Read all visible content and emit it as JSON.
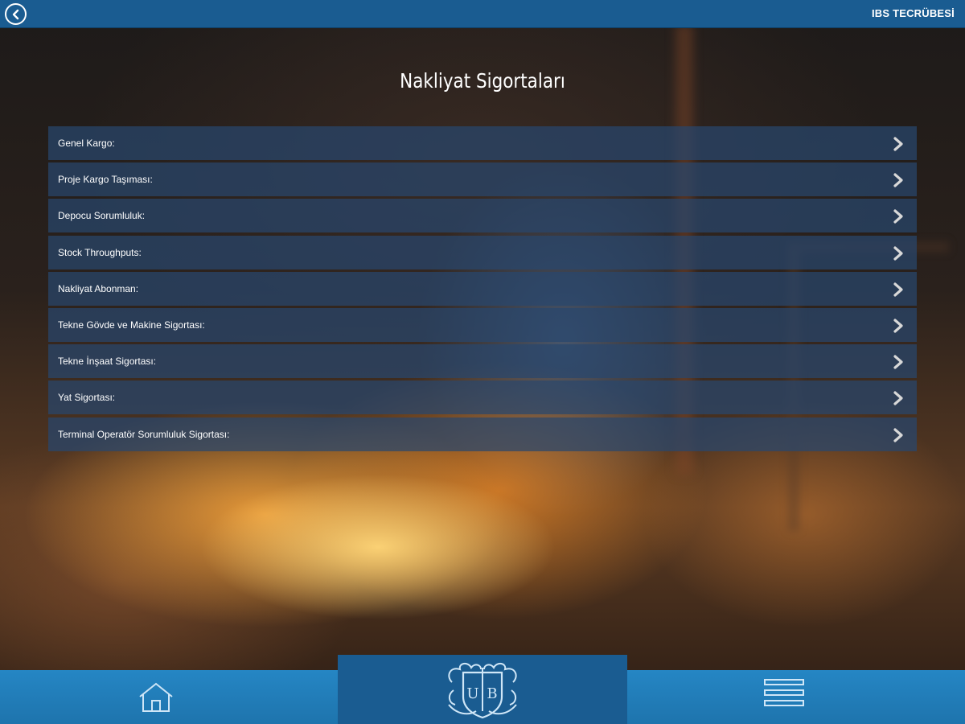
{
  "header": {
    "title": "IBS TECRÜBESİ",
    "back_icon": "back-circle-icon"
  },
  "page": {
    "title": "Nakliyat Sigortaları"
  },
  "menu": {
    "items": [
      {
        "label": "Genel Kargo:"
      },
      {
        "label": "Proje Kargo Taşıması:"
      },
      {
        "label": "Depocu Sorumluluk:"
      },
      {
        "label": "Stock Throughputs:"
      },
      {
        "label": "Nakliyat Abonman:"
      },
      {
        "label": "Tekne Gövde ve Makine Sigortası:"
      },
      {
        "label": "Tekne İnşaat Sigortası:"
      },
      {
        "label": "Yat Sigortası:"
      },
      {
        "label": "Terminal Operatör Sorumluluk Sigortası:"
      }
    ],
    "chevron_icon": "chevron-right-icon"
  },
  "footer": {
    "home_icon": "home-icon",
    "logo_text": "UB",
    "menu_icon": "hamburger-menu-icon"
  },
  "colors": {
    "topbar": "#1a5c91",
    "bottombar": "#1a7ab8",
    "menu_item_bg": "rgba(40,70,110,0.72)",
    "text": "#ffffff"
  }
}
